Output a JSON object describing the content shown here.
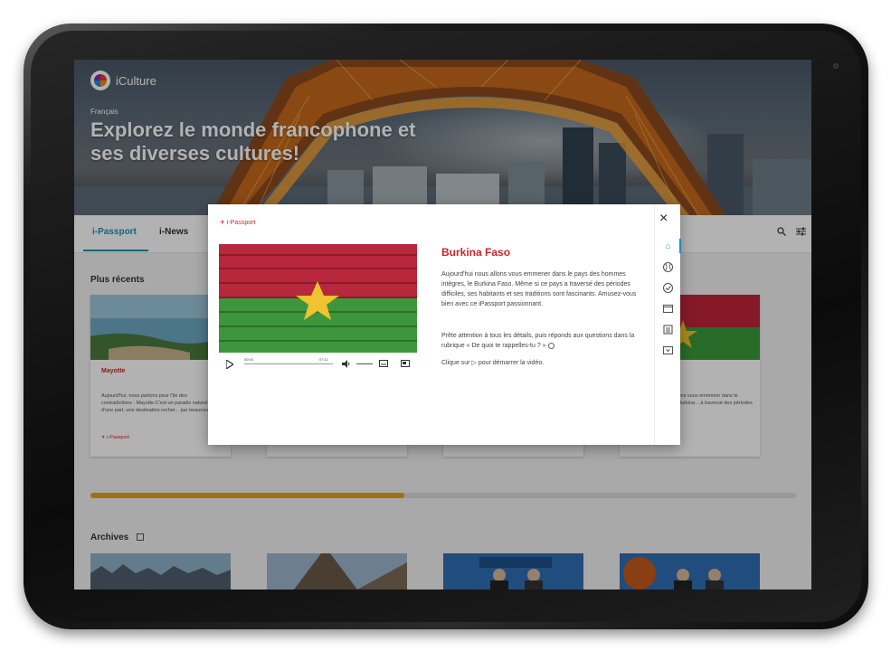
{
  "app": {
    "name": "iCulture",
    "language": "Français",
    "hero_title": "Explorez le monde francophone et ses diverses cultures!"
  },
  "nav": {
    "tabs": [
      {
        "label": "i-Passport",
        "active": true
      },
      {
        "label": "i-News",
        "active": false
      }
    ],
    "icons": [
      "search-icon",
      "filter-sliders-icon"
    ]
  },
  "sections": {
    "recent_title": "Plus récents",
    "archives_title": "Archives"
  },
  "cards": [
    {
      "title": "Mayotte",
      "text": "Aujourd'hui, nous partons pour l'île des contradictions : Mayotte.C'est un paradis naturel: d'une part, une destination recher... par beaucoup...",
      "tag": "i-Passport"
    },
    {
      "title": "",
      "text": "...ons vous emmener dans le ...Burkina ...à traversé des périodes",
      "tag": ""
    }
  ],
  "progress": {
    "fraction": 0.445
  },
  "modal": {
    "brand": "i-Passport",
    "title": "Burkina Faso",
    "paragraph1": "Aujourd'hui nous allons vous emmener dans le pays des hommes intègres, le Burkina Faso. Même si ce pays a traversé des périodes difficiles, ses habitants et ses traditions sont fascinants. Amusez-vous bien avec ce iPassport passionnant.",
    "paragraph2": "Prête attention à tous les détails, puis réponds aux questions dans la rubrique « De quoi te rappelles-tu ? »",
    "paragraph3_pre": "Clique sur",
    "paragraph3_post": "pour démarrer la vidéo.",
    "player": {
      "current_time": "00:00",
      "duration": "07:11"
    },
    "rail_icons": [
      "home-icon",
      "globe-icon",
      "check-circle-icon",
      "window-icon",
      "list-icon",
      "download-icon"
    ],
    "close_label": "×"
  },
  "colors": {
    "accent_red": "#c62828",
    "accent_blue": "#1f8fb7",
    "progress": "#e6a21d"
  }
}
